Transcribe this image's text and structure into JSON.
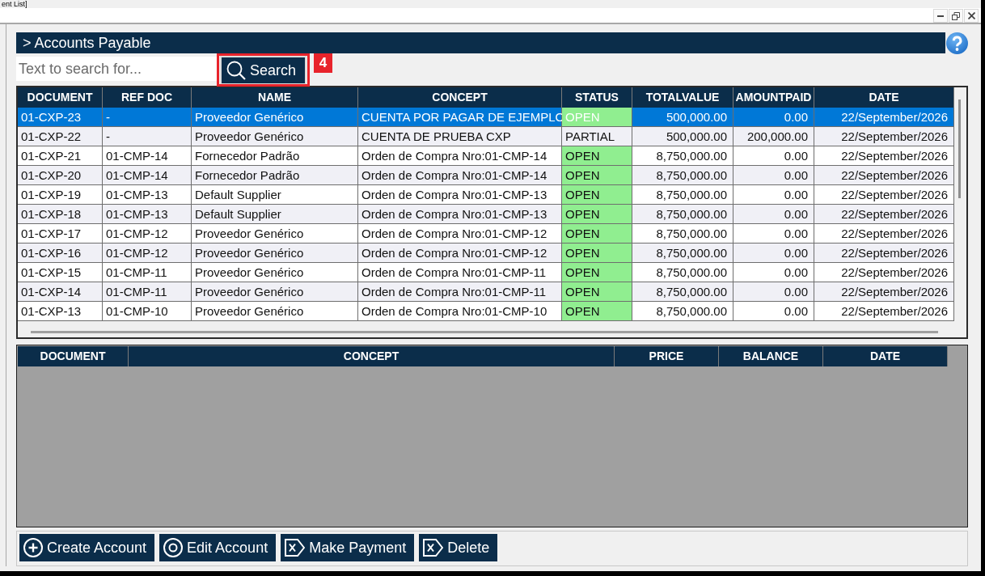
{
  "window": {
    "title": "ent List]"
  },
  "header": {
    "title": "> Accounts Payable"
  },
  "search": {
    "placeholder": "Text to search for...",
    "button": "Search",
    "callout": "4"
  },
  "accounts_table": {
    "columns": [
      "DOCUMENT",
      "REF DOC",
      "NAME",
      "CONCEPT",
      "STATUS",
      "TOTALVALUE",
      "AMOUNTPAID",
      "DATE"
    ],
    "rows": [
      {
        "selected": true,
        "document": "01-CXP-23",
        "ref_doc": "-",
        "name": "Proveedor Genérico",
        "concept": "CUENTA POR PAGAR DE EJEMPLO",
        "status": {
          "label": "OPEN",
          "color": "#90ee90"
        },
        "total_value": "500,000.00",
        "amount_paid": "0.00",
        "date": "22/September/2026"
      },
      {
        "selected": false,
        "document": "01-CXP-22",
        "ref_doc": "-",
        "name": "Proveedor Genérico",
        "concept": "CUENTA DE PRUEBA CXP",
        "status": {
          "label": "PARTIAL"
        },
        "total_value": "500,000.00",
        "amount_paid": "200,000.00",
        "date": "22/September/2026"
      },
      {
        "selected": false,
        "document": "01-CXP-21",
        "ref_doc": "01-CMP-14",
        "name": "Fornecedor Padrão",
        "concept": "Orden de Compra Nro:01-CMP-14",
        "status": {
          "label": "OPEN",
          "color": "#90ee90"
        },
        "total_value": "8,750,000.00",
        "amount_paid": "0.00",
        "date": "22/September/2026"
      },
      {
        "selected": false,
        "document": "01-CXP-20",
        "ref_doc": "01-CMP-14",
        "name": "Fornecedor Padrão",
        "concept": "Orden de Compra Nro:01-CMP-14",
        "status": {
          "label": "OPEN",
          "color": "#90ee90"
        },
        "total_value": "8,750,000.00",
        "amount_paid": "0.00",
        "date": "22/September/2026"
      },
      {
        "selected": false,
        "document": "01-CXP-19",
        "ref_doc": "01-CMP-13",
        "name": "Default Supplier",
        "concept": "Orden de Compra Nro:01-CMP-13",
        "status": {
          "label": "OPEN",
          "color": "#90ee90"
        },
        "total_value": "8,750,000.00",
        "amount_paid": "0.00",
        "date": "22/September/2026"
      },
      {
        "selected": false,
        "document": "01-CXP-18",
        "ref_doc": "01-CMP-13",
        "name": "Default Supplier",
        "concept": "Orden de Compra Nro:01-CMP-13",
        "status": {
          "label": "OPEN",
          "color": "#90ee90"
        },
        "total_value": "8,750,000.00",
        "amount_paid": "0.00",
        "date": "22/September/2026"
      },
      {
        "selected": false,
        "document": "01-CXP-17",
        "ref_doc": "01-CMP-12",
        "name": "Proveedor Genérico",
        "concept": "Orden de Compra Nro:01-CMP-12",
        "status": {
          "label": "OPEN",
          "color": "#90ee90"
        },
        "total_value": "8,750,000.00",
        "amount_paid": "0.00",
        "date": "22/September/2026"
      },
      {
        "selected": false,
        "document": "01-CXP-16",
        "ref_doc": "01-CMP-12",
        "name": "Proveedor Genérico",
        "concept": "Orden de Compra Nro:01-CMP-12",
        "status": {
          "label": "OPEN",
          "color": "#90ee90"
        },
        "total_value": "8,750,000.00",
        "amount_paid": "0.00",
        "date": "22/September/2026"
      },
      {
        "selected": false,
        "document": "01-CXP-15",
        "ref_doc": "01-CMP-11",
        "name": "Proveedor Genérico",
        "concept": "Orden de Compra Nro:01-CMP-11",
        "status": {
          "label": "OPEN",
          "color": "#90ee90"
        },
        "total_value": "8,750,000.00",
        "amount_paid": "0.00",
        "date": "22/September/2026"
      },
      {
        "selected": false,
        "document": "01-CXP-14",
        "ref_doc": "01-CMP-11",
        "name": "Proveedor Genérico",
        "concept": "Orden de Compra Nro:01-CMP-11",
        "status": {
          "label": "OPEN",
          "color": "#90ee90"
        },
        "total_value": "8,750,000.00",
        "amount_paid": "0.00",
        "date": "22/September/2026"
      },
      {
        "selected": false,
        "document": "01-CXP-13",
        "ref_doc": "01-CMP-10",
        "name": "Proveedor Genérico",
        "concept": "Orden de Compra Nro:01-CMP-10",
        "status": {
          "label": "OPEN",
          "color": "#90ee90"
        },
        "total_value": "8,750,000.00",
        "amount_paid": "0.00",
        "date": "22/September/2026"
      }
    ]
  },
  "details_table": {
    "columns": [
      "DOCUMENT",
      "CONCEPT",
      "PRICE",
      "BALANCE",
      "DATE"
    ]
  },
  "buttons": [
    {
      "label": "Create Account",
      "kind": "add"
    },
    {
      "label": "Edit Account",
      "kind": "edit"
    },
    {
      "label": "Make Payment",
      "kind": "pay"
    },
    {
      "label": "Delete",
      "kind": "delete"
    }
  ]
}
